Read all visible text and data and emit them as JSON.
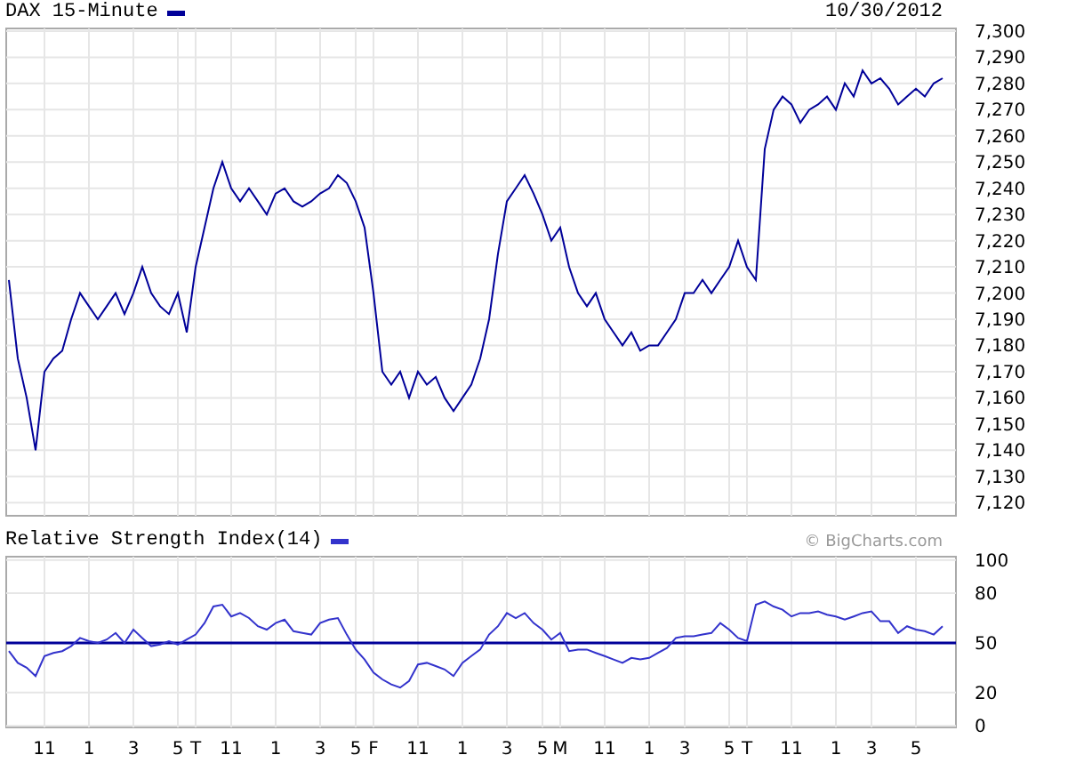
{
  "header": {
    "date": "10/30/2012"
  },
  "price_chart": {
    "chart_data": {
      "type": "line",
      "title": "DAX 15-Minute",
      "grid": true,
      "ylim": [
        7115,
        7301
      ],
      "yticks": [
        {
          "value": 7300,
          "label": "7,300"
        },
        {
          "value": 7290,
          "label": "7,290"
        },
        {
          "value": 7280,
          "label": "7,280"
        },
        {
          "value": 7270,
          "label": "7,270"
        },
        {
          "value": 7260,
          "label": "7,260"
        },
        {
          "value": 7250,
          "label": "7,250"
        },
        {
          "value": 7240,
          "label": "7,240"
        },
        {
          "value": 7230,
          "label": "7,230"
        },
        {
          "value": 7220,
          "label": "7,220"
        },
        {
          "value": 7210,
          "label": "7,210"
        },
        {
          "value": 7200,
          "label": "7,200"
        },
        {
          "value": 7190,
          "label": "7,190"
        },
        {
          "value": 7180,
          "label": "7,180"
        },
        {
          "value": 7170,
          "label": "7,170"
        },
        {
          "value": 7160,
          "label": "7,160"
        },
        {
          "value": 7150,
          "label": "7,150"
        },
        {
          "value": 7140,
          "label": "7,140"
        },
        {
          "value": 7130,
          "label": "7,130"
        },
        {
          "value": 7120,
          "label": "7,120"
        }
      ],
      "series": [
        {
          "color": "#000099",
          "values": [
            7205,
            7175,
            7160,
            7140,
            7170,
            7175,
            7178,
            7190,
            7200,
            7195,
            7190,
            7195,
            7200,
            7192,
            7200,
            7210,
            7200,
            7195,
            7192,
            7200,
            7185,
            7210,
            7225,
            7240,
            7250,
            7240,
            7235,
            7240,
            7235,
            7230,
            7238,
            7240,
            7235,
            7233,
            7235,
            7238,
            7240,
            7245,
            7242,
            7235,
            7225,
            7200,
            7170,
            7165,
            7170,
            7160,
            7170,
            7165,
            7168,
            7160,
            7155,
            7160,
            7165,
            7175,
            7190,
            7215,
            7235,
            7240,
            7245,
            7238,
            7230,
            7220,
            7225,
            7210,
            7200,
            7195,
            7200,
            7190,
            7185,
            7180,
            7185,
            7178,
            7180,
            7180,
            7185,
            7190,
            7200,
            7200,
            7205,
            7200,
            7205,
            7210,
            7220,
            7210,
            7205,
            7255,
            7270,
            7275,
            7272,
            7265,
            7270,
            7272,
            7275,
            7270,
            7280,
            7275,
            7285,
            7280,
            7282,
            7278,
            7272,
            7275,
            7278,
            7275,
            7280,
            7282
          ]
        }
      ]
    }
  },
  "rsi_chart": {
    "credit": "© BigCharts.com",
    "chart_data": {
      "type": "line",
      "title": "Relative Strength Index(14)",
      "grid": true,
      "categories": [
        null,
        null,
        null,
        null,
        "11",
        null,
        null,
        null,
        null,
        "1",
        null,
        null,
        null,
        null,
        "3",
        null,
        null,
        null,
        null,
        "5",
        null,
        "T",
        null,
        null,
        null,
        "11",
        null,
        null,
        null,
        null,
        "1",
        null,
        null,
        null,
        null,
        "3",
        null,
        null,
        null,
        "5",
        null,
        "F",
        null,
        null,
        null,
        null,
        "11",
        null,
        null,
        null,
        null,
        "1",
        null,
        null,
        null,
        null,
        "3",
        null,
        null,
        null,
        "5",
        null,
        "M",
        null,
        null,
        null,
        null,
        "11",
        null,
        null,
        null,
        null,
        "1",
        null,
        null,
        null,
        "3",
        null,
        null,
        null,
        null,
        "5",
        null,
        "T",
        null,
        null,
        null,
        null,
        "11",
        null,
        null,
        null,
        null,
        "1",
        null,
        null,
        null,
        "3",
        null,
        null,
        null,
        null,
        "5",
        null,
        null,
        null
      ],
      "ylim": [
        -1,
        102
      ],
      "yticks": [
        0,
        20,
        50,
        80,
        100
      ],
      "ref_lines": [
        {
          "axis": "y",
          "value": 50,
          "color": "#000099"
        }
      ],
      "series": [
        {
          "color": "#3333cc",
          "values": [
            45,
            38,
            35,
            30,
            42,
            44,
            45,
            48,
            53,
            51,
            50,
            52,
            56,
            50,
            58,
            53,
            48,
            49,
            51,
            49,
            52,
            55,
            62,
            72,
            73,
            66,
            68,
            65,
            60,
            58,
            62,
            64,
            57,
            56,
            55,
            62,
            64,
            65,
            55,
            46,
            40,
            32,
            28,
            25,
            23,
            27,
            37,
            38,
            36,
            34,
            30,
            38,
            42,
            46,
            55,
            60,
            68,
            65,
            68,
            62,
            58,
            52,
            56,
            45,
            46,
            46,
            44,
            42,
            40,
            38,
            41,
            40,
            41,
            44,
            47,
            53,
            54,
            54,
            55,
            56,
            62,
            58,
            53,
            51,
            73,
            75,
            72,
            70,
            66,
            68,
            68,
            69,
            67,
            66,
            64,
            66,
            68,
            69,
            63,
            63,
            56,
            60,
            58,
            57,
            55,
            60
          ]
        }
      ]
    }
  }
}
